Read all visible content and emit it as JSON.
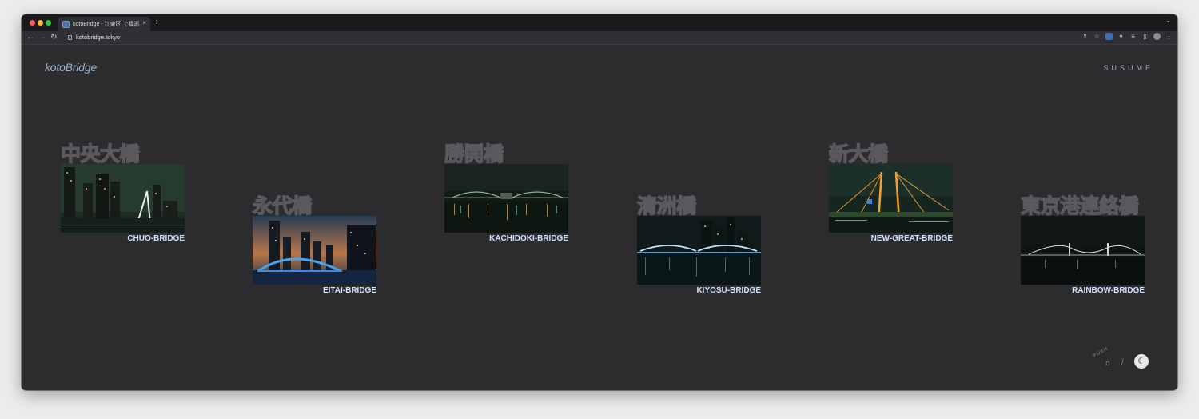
{
  "browser": {
    "tab_title": "kotoBridge - 江東区 で橋巡り",
    "tab_close": "×",
    "new_tab": "+",
    "tab_dropdown": "⌄",
    "url": "kotobridge.tokyo",
    "nav": {
      "back": "←",
      "forward": "→",
      "reload": "↻"
    },
    "toolbar_icons": [
      "share-icon",
      "star-icon",
      "extension-blue-icon",
      "puzzle-icon",
      "reading-list-icon",
      "sidebar-icon",
      "avatar-icon",
      "kebab-menu-icon"
    ]
  },
  "site": {
    "logo": "kotoBridge",
    "nav_label": "SUSUME"
  },
  "bridges": [
    {
      "jp": "中央大橋",
      "en": "CHUO-BRIDGE",
      "palette": "green-skyline"
    },
    {
      "jp": "永代橋",
      "en": "EITAI-BRIDGE",
      "palette": "sunset-blue-arch"
    },
    {
      "jp": "勝鬨橋",
      "en": "KACHIDOKI-BRIDGE",
      "palette": "dark-green-truss"
    },
    {
      "jp": "清洲橋",
      "en": "KIYOSU-BRIDGE",
      "palette": "blue-suspension"
    },
    {
      "jp": "新大橋",
      "en": "NEW-GREAT-BRIDGE",
      "palette": "orange-pylons"
    },
    {
      "jp": "東京港連絡橋",
      "en": "RAINBOW-BRIDGE",
      "palette": "night-suspension"
    }
  ],
  "theme_switch": {
    "push_label": "PUSH",
    "sun": "☼",
    "slash": "/",
    "moon": "☾"
  }
}
